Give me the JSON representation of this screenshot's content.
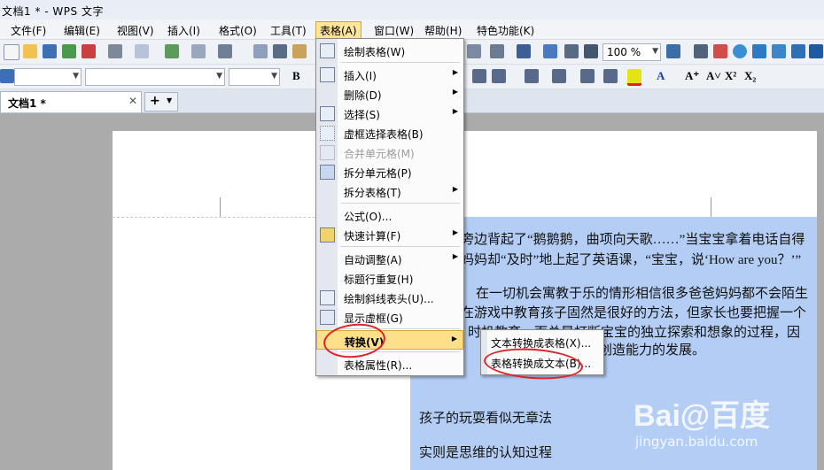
{
  "title_bar": {
    "text": "文档1 * - WPS 文字"
  },
  "menu_bar": {
    "items": [
      {
        "label": "文件(F)"
      },
      {
        "label": "编辑(E)"
      },
      {
        "label": "视图(V)"
      },
      {
        "label": "插入(I)"
      },
      {
        "label": "格式(O)"
      },
      {
        "label": "工具(T)"
      },
      {
        "label": "表格(A)"
      },
      {
        "label": "窗口(W)"
      },
      {
        "label": "帮助(H)"
      },
      {
        "label": "特色功能(K)"
      }
    ],
    "active_index": 6
  },
  "toolbar": {
    "zoom": "100 %"
  },
  "tabs": {
    "doc_tab": "文档1 *",
    "new_tab": "+"
  },
  "document": {
    "lines": [
      "旁边背起了“鹅鹅鹅，曲项向天歌……”当宝宝拿着电话自得",
      "妈妈却“及时”地上起了英语课，“宝宝，说‘How are you？’”",
      "在一切机会寓教于乐的情形相信很多爸爸妈妈都不会陌生",
      "在游戏中教育孩子固然是很好的方法，但家长也要把握一个",
      "时机教育，而总是打断宝宝的独立探索和想象的过程，因",
      "创造能力的发展。",
      "孩子的玩耍看似无章法",
      "实则是思维的认知过程"
    ]
  },
  "table_menu": {
    "items": [
      {
        "label": "绘制表格(W)",
        "icon": "draw-table-icon"
      },
      {
        "label": "插入(I)",
        "icon": "insert-table-icon",
        "submenu": true
      },
      {
        "label": "删除(D)",
        "submenu": true
      },
      {
        "label": "选择(S)",
        "icon": "select-table-icon",
        "submenu": true
      },
      {
        "label": "虚框选择表格(B)",
        "icon": "dotted-select-icon"
      },
      {
        "label": "合并单元格(M)",
        "icon": "merge-cells-icon",
        "disabled": true
      },
      {
        "label": "拆分单元格(P)",
        "icon": "split-cells-icon"
      },
      {
        "label": "拆分表格(T)",
        "submenu": true
      },
      {
        "label": "公式(O)..."
      },
      {
        "label": "快速计算(F)",
        "icon": "quick-calc-icon",
        "submenu": true
      },
      {
        "label": "自动调整(A)",
        "submenu": true
      },
      {
        "label": "标题行重复(H)"
      },
      {
        "label": "绘制斜线表头(U)...",
        "icon": "diagonal-header-icon"
      },
      {
        "label": "显示虚框(G)",
        "icon": "show-gridlines-icon"
      },
      {
        "label": "转换(V)",
        "submenu": true,
        "highlighted": true
      },
      {
        "label": "表格属性(R)..."
      }
    ]
  },
  "convert_submenu": {
    "items": [
      {
        "label": "文本转换成表格(X)..."
      },
      {
        "label": "表格转换成文本(B)..."
      }
    ]
  },
  "watermark": {
    "brand": "Bai@百度",
    "sub": "jingyan.baidu.com"
  }
}
